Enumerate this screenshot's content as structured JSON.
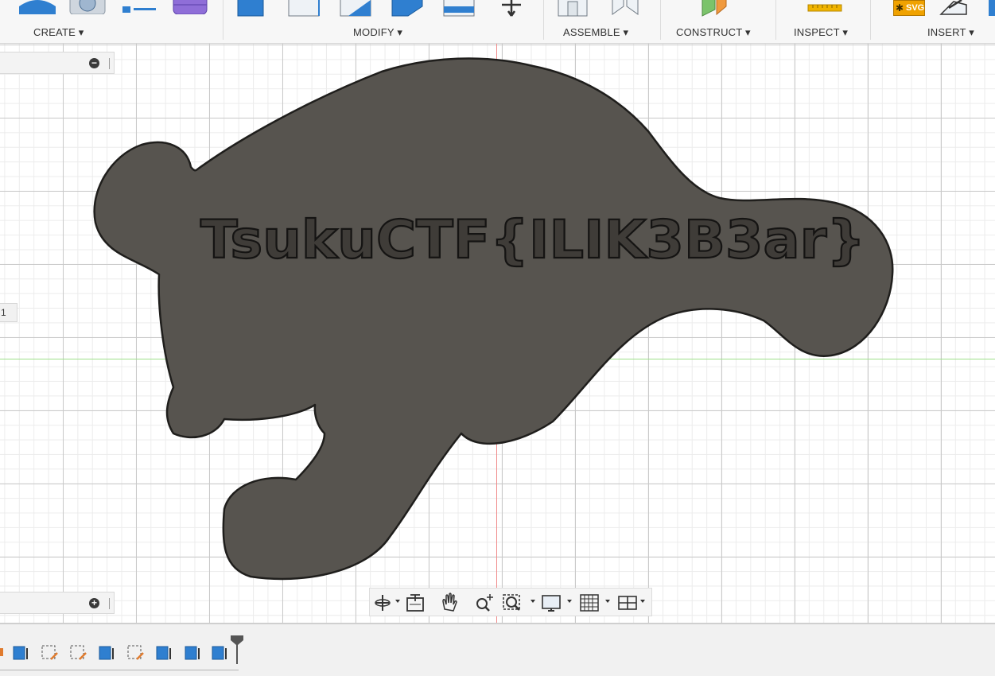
{
  "toolbar": {
    "groups": [
      {
        "label": "CREATE ▾"
      },
      {
        "label": "MODIFY ▾"
      },
      {
        "label": "ASSEMBLE ▾"
      },
      {
        "label": "CONSTRUCT ▾"
      },
      {
        "label": "INSPECT ▾"
      },
      {
        "label": "INSERT ▾"
      }
    ],
    "svg_badge": "SVG"
  },
  "panels": {
    "browser_collapse": "−",
    "comments_expand": "+",
    "side_fragment": "1"
  },
  "model": {
    "engraved_text": "TsukuCTF{ILIK3B3ar}",
    "body_color": "#57544f",
    "text_color": "#3f3c38"
  },
  "canvas": {
    "x_axis_color": "#9fe08a",
    "y_axis_color": "#f08a8a"
  },
  "navbar": {
    "tools": [
      "orbit-icon",
      "look-at-icon",
      "pan-icon",
      "zoom-icon",
      "fit-icon",
      "display-settings-icon",
      "grid-settings-icon",
      "viewports-icon"
    ]
  },
  "timeline": {
    "items": [
      "extrude",
      "sketch",
      "sketch",
      "extrude",
      "sketch",
      "extrude",
      "extrude",
      "extrude"
    ]
  }
}
